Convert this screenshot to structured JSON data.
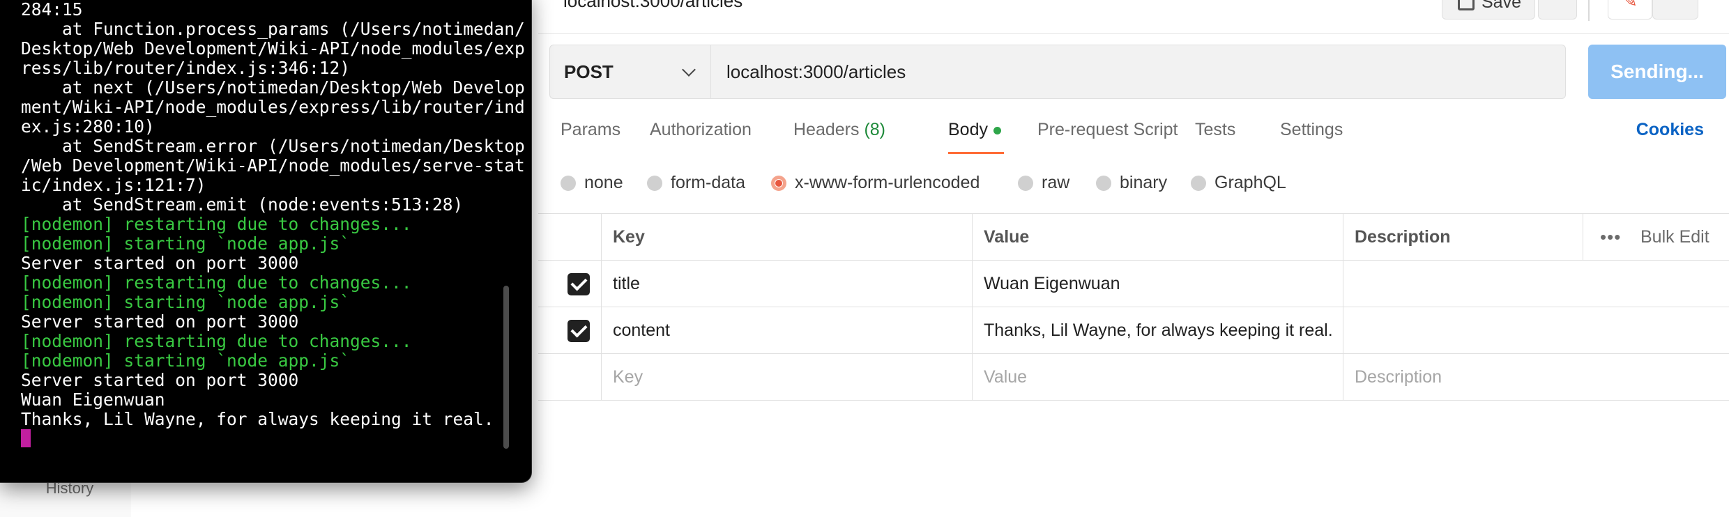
{
  "sidebar": {
    "history_label": "History"
  },
  "topbar": {
    "url": "localhost:3000/articles",
    "save_label": "Save"
  },
  "request": {
    "method": "POST",
    "url": "localhost:3000/articles",
    "send_label": "Sending..."
  },
  "tabs": [
    {
      "label": "Params"
    },
    {
      "label": "Authorization"
    },
    {
      "label": "Headers",
      "count": "(8)"
    },
    {
      "label": "Body"
    },
    {
      "label": "Pre-request Script"
    },
    {
      "label": "Tests"
    },
    {
      "label": "Settings"
    }
  ],
  "cookies_label": "Cookies",
  "body_types": [
    {
      "label": "none",
      "selected": false
    },
    {
      "label": "form-data",
      "selected": false
    },
    {
      "label": "x-www-form-urlencoded",
      "selected": true
    },
    {
      "label": "raw",
      "selected": false
    },
    {
      "label": "binary",
      "selected": false
    },
    {
      "label": "GraphQL",
      "selected": false
    }
  ],
  "table": {
    "headers": {
      "key": "Key",
      "value": "Value",
      "description": "Description",
      "bulk_edit": "Bulk Edit"
    },
    "rows": [
      {
        "checked": true,
        "key": "title",
        "value": "Wuan Eigenwuan",
        "description": ""
      },
      {
        "checked": true,
        "key": "content",
        "value": "Thanks, Lil Wayne, for always keeping it real.",
        "description": ""
      }
    ],
    "placeholders": {
      "key": "Key",
      "value": "Value",
      "description": "Description"
    }
  },
  "terminal": {
    "lines": [
      {
        "text": "284:15",
        "color": "white"
      },
      {
        "text": "    at Function.process_params (/Users/notimedan/",
        "color": "white"
      },
      {
        "text": "Desktop/Web Development/Wiki-API/node_modules/exp",
        "color": "white"
      },
      {
        "text": "ress/lib/router/index.js:346:12)",
        "color": "white"
      },
      {
        "text": "    at next (/Users/notimedan/Desktop/Web Develop",
        "color": "white"
      },
      {
        "text": "ment/Wiki-API/node_modules/express/lib/router/ind",
        "color": "white"
      },
      {
        "text": "ex.js:280:10)",
        "color": "white"
      },
      {
        "text": "    at SendStream.error (/Users/notimedan/Desktop",
        "color": "white"
      },
      {
        "text": "/Web Development/Wiki-API/node_modules/serve-stat",
        "color": "white"
      },
      {
        "text": "ic/index.js:121:7)",
        "color": "white"
      },
      {
        "text": "    at SendStream.emit (node:events:513:28)",
        "color": "white"
      },
      {
        "text": "[nodemon] restarting due to changes...",
        "color": "green"
      },
      {
        "text": "[nodemon] starting `node app.js`",
        "color": "green"
      },
      {
        "text": "Server started on port 3000",
        "color": "white"
      },
      {
        "text": "[nodemon] restarting due to changes...",
        "color": "green"
      },
      {
        "text": "[nodemon] starting `node app.js`",
        "color": "green"
      },
      {
        "text": "Server started on port 3000",
        "color": "white"
      },
      {
        "text": "[nodemon] restarting due to changes...",
        "color": "green"
      },
      {
        "text": "[nodemon] starting `node app.js`",
        "color": "green"
      },
      {
        "text": "Server started on port 3000",
        "color": "white"
      },
      {
        "text": "Wuan Eigenwuan",
        "color": "white"
      },
      {
        "text": "Thanks, Lil Wayne, for always keeping it real.",
        "color": "white"
      }
    ]
  },
  "colors": {
    "accent_orange": "#ff6c37",
    "send_button": "#8ec1f3",
    "link_blue": "#0b63c4",
    "terminal_green": "#39c942",
    "cursor_magenta": "#c21fa0"
  }
}
